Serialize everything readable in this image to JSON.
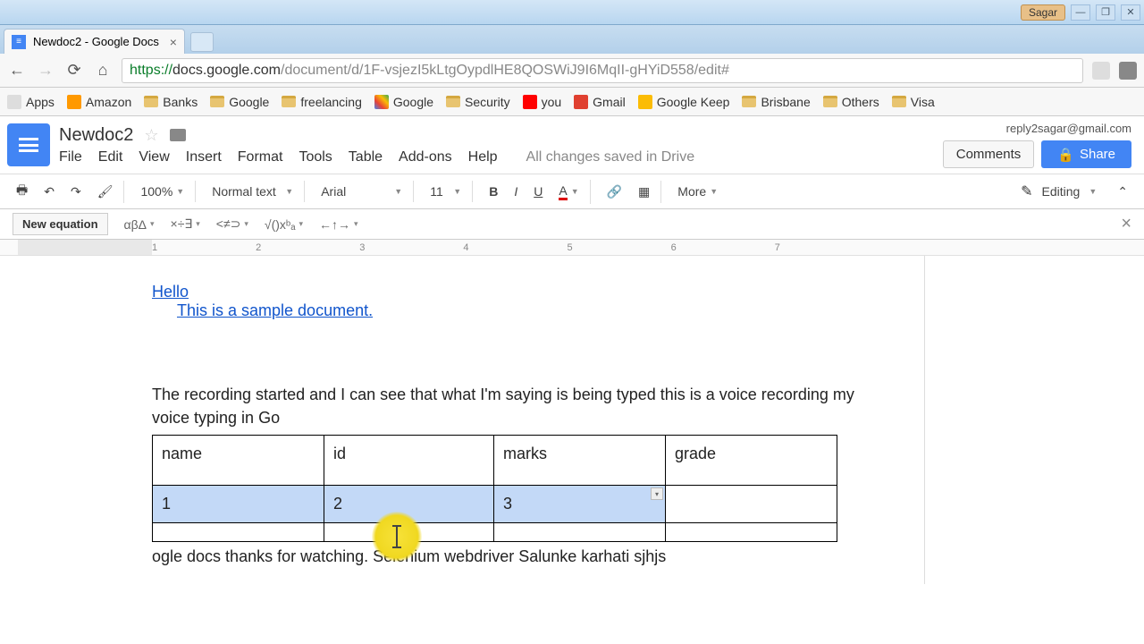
{
  "browser": {
    "os_user": "Sagar",
    "tab_title": "Newdoc2 - Google Docs",
    "url_proto": "https://",
    "url_host": "docs.google.com",
    "url_path": "/document/d/1F-vsjezI5kLtgOypdlHE8QOSWiJ9I6MqII-gHYiD558/edit#",
    "bookmarks": [
      "Apps",
      "Amazon",
      "Banks",
      "Google",
      "freelancing",
      "Google",
      "Security",
      "you",
      "Gmail",
      "Google Keep",
      "Brisbane",
      "Others",
      "Visa"
    ]
  },
  "docs": {
    "title": "Newdoc2",
    "email": "reply2sagar@gmail.com",
    "menus": [
      "File",
      "Edit",
      "View",
      "Insert",
      "Format",
      "Tools",
      "Table",
      "Add-ons",
      "Help"
    ],
    "saved_msg": "All changes saved in Drive",
    "comments_label": "Comments",
    "share_label": "Share",
    "zoom": "100%",
    "style": "Normal text",
    "font": "Arial",
    "size": "11",
    "more": "More",
    "mode": "Editing",
    "eq_new": "New equation",
    "eq_groups": [
      "αβΔ",
      "×÷∃",
      "<≠⊃",
      "√()xᵇₐ",
      "←↑→"
    ]
  },
  "content": {
    "link1": "Hello",
    "link2": "This is a sample document.",
    "para": "The recording started and I can see that what I'm saying is being typed this is a voice recording my voice typing in Go",
    "table": {
      "headers": [
        "name",
        "id",
        "marks",
        "grade"
      ],
      "rows": [
        [
          "1",
          "2",
          "3",
          ""
        ],
        [
          "",
          "",
          "",
          ""
        ]
      ]
    },
    "after": "ogle docs thanks for watching. Selenium webdriver  Salunke karhati  sjhjs"
  }
}
